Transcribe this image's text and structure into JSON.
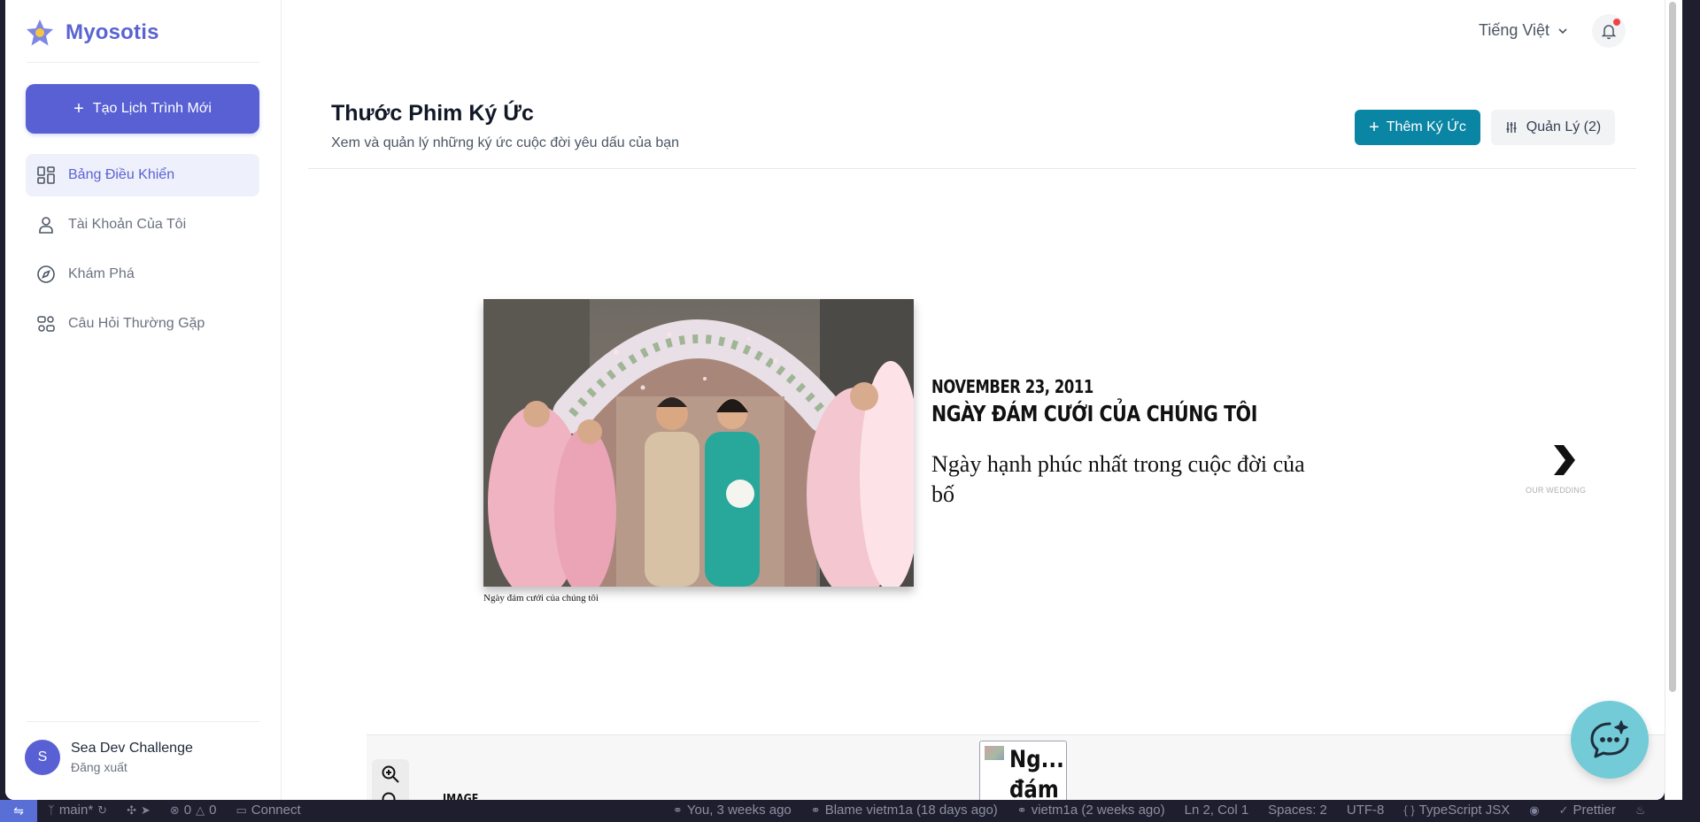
{
  "sidebar": {
    "brand": "Myosotis",
    "new_button": "Tạo Lịch Trình Mới",
    "items": [
      {
        "label": "Bảng Điều Khiển",
        "active": true
      },
      {
        "label": "Tài Khoản Của Tôi"
      },
      {
        "label": "Khám Phá"
      },
      {
        "label": "Câu Hỏi Thường Gặp"
      }
    ],
    "user": {
      "initial": "S",
      "name": "Sea Dev Challenge",
      "logout": "Đăng xuất"
    }
  },
  "header": {
    "language": "Tiếng Việt"
  },
  "page": {
    "title": "Thước Phim Ký Ức",
    "subtitle": "Xem và quản lý những ký ức cuộc đời yêu dấu của bạn",
    "add_button": "Thêm Ký Ức",
    "manage_button": "Quản Lý (2)"
  },
  "slide": {
    "photo_caption": "Ngày đám cưới của chúng tôi",
    "date": "NOVEMBER 23, 2011",
    "headline": "NGÀY ĐÁM CƯỚI CỦA CHÚNG TÔI",
    "text": "Ngày hạnh phúc nhất trong cuộc đời của bố",
    "next_label": "OUR WEDDING"
  },
  "navigator": {
    "type_label": "IMAGE",
    "marker_text": "Ng... đám"
  },
  "colors": {
    "brand": "#5b63d3",
    "primary_button": "#5860d4",
    "teal_button": "#0b85a4",
    "chat_fab": "#72cbd6",
    "notification_dot": "#ef4444"
  },
  "statusbar": {
    "branch": "main*",
    "problems": "0",
    "warnings": "0",
    "connect": "Connect",
    "blame_you": "You, 3 weeks ago",
    "blame_author": "Blame vietm1a (18 days ago)",
    "blame_line": "vietm1a (2 weeks ago)",
    "cursor": "Ln 2, Col 1",
    "spaces": "Spaces: 2",
    "encoding": "UTF-8",
    "language": "TypeScript JSX",
    "prettier": "Prettier"
  }
}
